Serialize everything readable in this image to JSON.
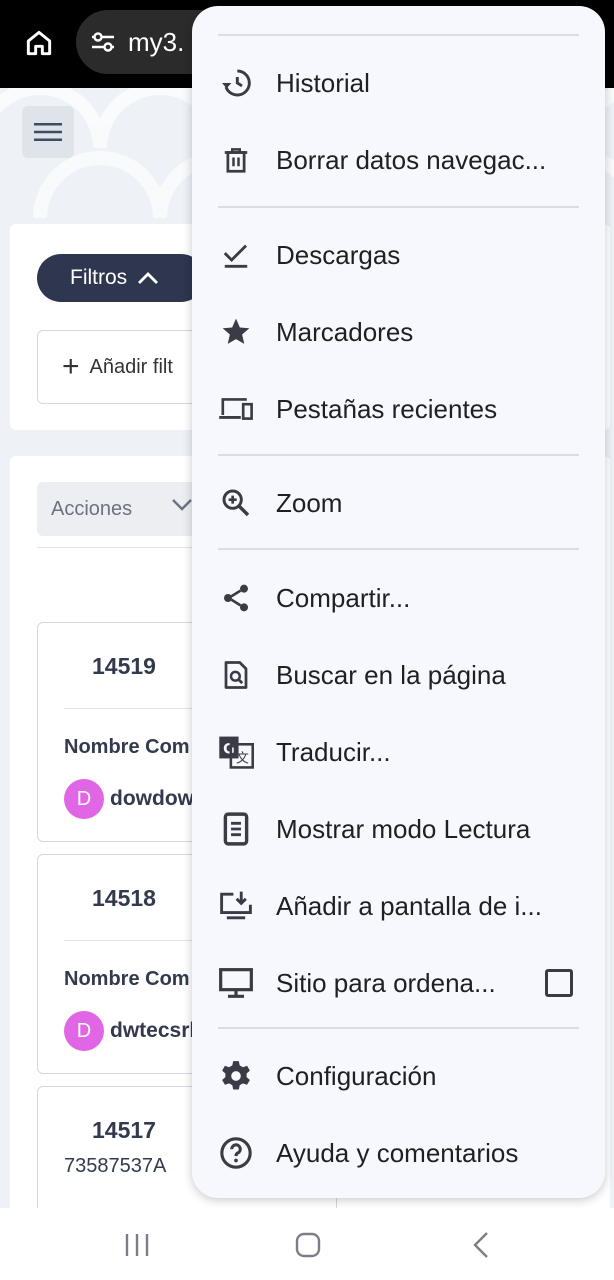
{
  "browser": {
    "url_text": "my3.",
    "icons": {
      "home": "home-icon",
      "site_settings": "tune-icon"
    }
  },
  "page": {
    "filters_button": "Filtros",
    "add_filter": "Añadir filt",
    "actions_select": "Acciones",
    "records": [
      {
        "id": "14519",
        "label": "Nombre Com",
        "avatar": "D",
        "user": "dowdow"
      },
      {
        "id": "14518",
        "label": "Nombre Com",
        "avatar": "D",
        "user": "dwtecsrl"
      },
      {
        "id": "14517",
        "sub": "73587537A"
      }
    ]
  },
  "menu": {
    "items": [
      {
        "id": "historial",
        "label": "Historial",
        "icon": "history-icon"
      },
      {
        "id": "borrar",
        "label": "Borrar datos navegac...",
        "icon": "trash-icon"
      },
      {
        "id": "descargas",
        "label": "Descargas",
        "icon": "download-check-icon"
      },
      {
        "id": "marcadores",
        "label": "Marcadores",
        "icon": "star-icon"
      },
      {
        "id": "pestanas",
        "label": "Pestañas recientes",
        "icon": "devices-icon"
      },
      {
        "id": "zoom",
        "label": "Zoom",
        "icon": "zoom-in-icon"
      },
      {
        "id": "compartir",
        "label": "Compartir...",
        "icon": "share-icon"
      },
      {
        "id": "buscar",
        "label": "Buscar en la página",
        "icon": "find-in-page-icon"
      },
      {
        "id": "traducir",
        "label": "Traducir...",
        "icon": "translate-icon"
      },
      {
        "id": "lectura",
        "label": "Mostrar modo Lectura",
        "icon": "reader-mode-icon"
      },
      {
        "id": "anadir",
        "label": "Añadir a pantalla de i...",
        "icon": "install-desktop-icon"
      },
      {
        "id": "sitio",
        "label": "Sitio para ordena...",
        "icon": "desktop-icon",
        "checked": false
      },
      {
        "id": "config",
        "label": "Configuración",
        "icon": "settings-icon"
      },
      {
        "id": "ayuda",
        "label": "Ayuda y comentarios",
        "icon": "help-icon"
      }
    ]
  },
  "colors": {
    "menu_bg": "#f7f8fd",
    "filters_bg": "#2e3650",
    "avatar_bg": "#e066e6"
  },
  "system_nav": {
    "recents": "recents-icon",
    "home": "home-nav-icon",
    "back": "back-icon"
  }
}
